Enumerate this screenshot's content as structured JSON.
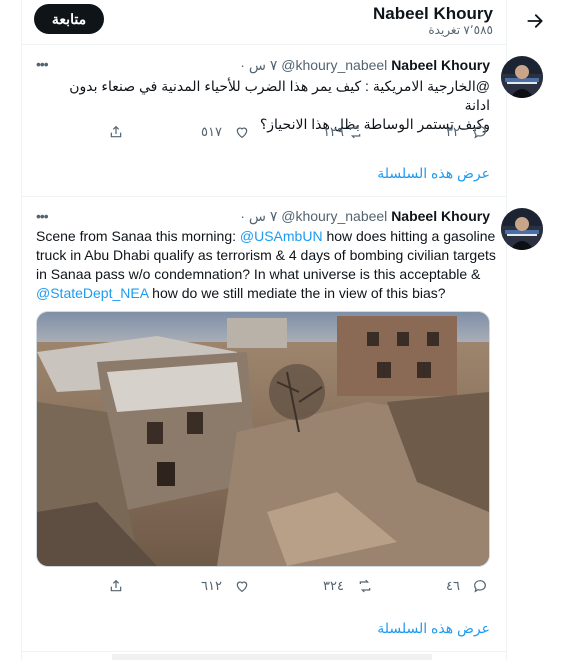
{
  "header": {
    "name": "Nabeel Khoury",
    "tweet_count": "٧٬٥٨٥ تغريدة",
    "follow_label": "متابعة"
  },
  "tweets": [
    {
      "name": "Nabeel Khoury",
      "handle": "@khoury_nabeel",
      "time": "· ٧ س",
      "text_line1": "@الخارجية الامريكية : كيف يمر هذا الضرب للأحياء المدنية في صنعاء بدون ادانة",
      "text_line2": "وكيف تستمر الوساطة بظل هذا الانحياز؟",
      "replies": "٣٢",
      "retweets": "١٢٩",
      "likes": "٥١٧",
      "show_thread": "عرض هذه السلسلة"
    },
    {
      "name": "Nabeel Khoury",
      "handle": "@khoury_nabeel",
      "time": "· ٧ س",
      "text_part1": "Scene from Sanaa this morning: ",
      "mention1": "@USAmbUN",
      "text_part2": " how does hitting a gasoline truck in Abu Dhabi qualify as terrorism & 4 days of bombing civilian targets in Sanaa pass w/o condemnation? In what universe is this acceptable & ",
      "mention2": "@StateDept_NEA",
      "text_part3": " how do we still mediate the in view of this bias?",
      "replies": "٤٦",
      "retweets": "٣٢٤",
      "likes": "٦١٢",
      "show_thread": "عرض هذه السلسلة"
    }
  ],
  "colors": {
    "accent": "#1d9bf0",
    "secondary_text": "#536471",
    "primary_text": "#0f1419"
  }
}
